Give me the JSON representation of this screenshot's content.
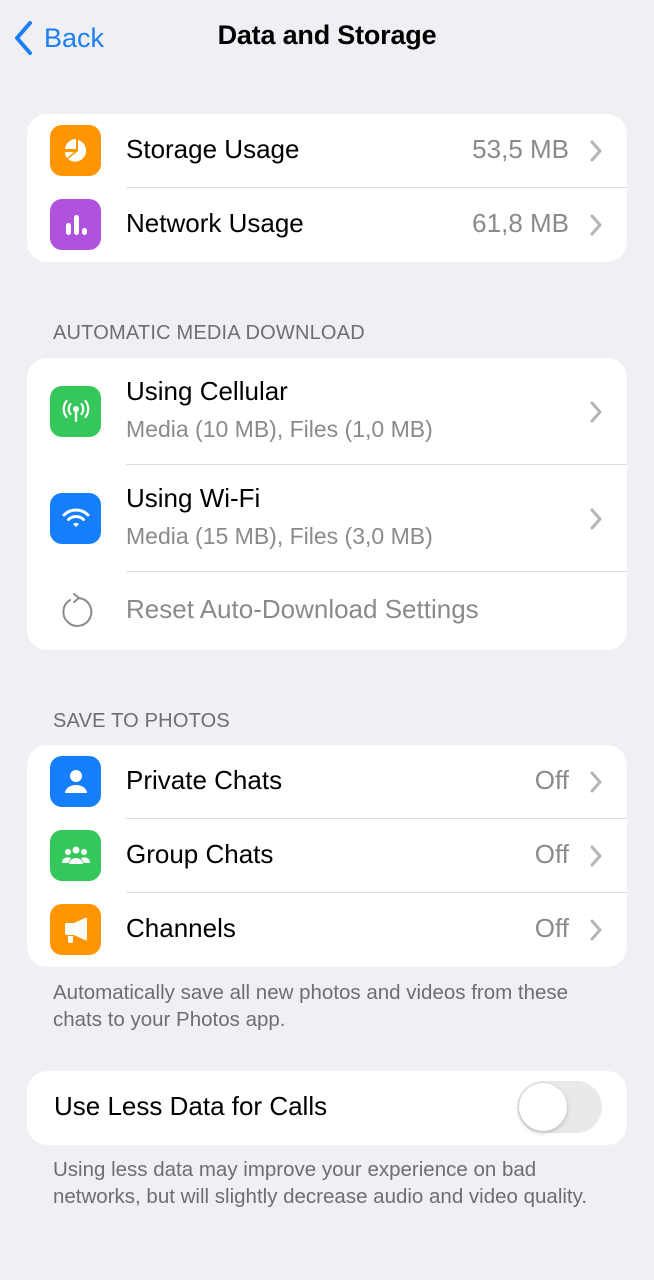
{
  "nav": {
    "back_label": "Back",
    "title": "Data and Storage"
  },
  "usage": {
    "items": [
      {
        "label": "Storage Usage",
        "value": "53,5 MB",
        "icon": "pie-chart-icon",
        "color": "#ff9500"
      },
      {
        "label": "Network Usage",
        "value": "61,8 MB",
        "icon": "bar-chart-icon",
        "color": "#af52de"
      }
    ]
  },
  "auto_download": {
    "header": "AUTOMATIC MEDIA DOWNLOAD",
    "items": [
      {
        "label": "Using Cellular",
        "sublabel": "Media (10 MB), Files (1,0 MB)",
        "icon": "cellular-antenna-icon",
        "color": "#34c759"
      },
      {
        "label": "Using Wi-Fi",
        "sublabel": "Media (15 MB), Files (3,0 MB)",
        "icon": "wifi-icon",
        "color": "#157efb"
      }
    ],
    "reset_label": "Reset Auto-Download Settings"
  },
  "save_to_photos": {
    "header": "SAVE TO PHOTOS",
    "items": [
      {
        "label": "Private Chats",
        "value": "Off",
        "icon": "person-icon",
        "color": "#157efb"
      },
      {
        "label": "Group Chats",
        "value": "Off",
        "icon": "group-icon",
        "color": "#34c759"
      },
      {
        "label": "Channels",
        "value": "Off",
        "icon": "megaphone-icon",
        "color": "#ff9500"
      }
    ],
    "footer": "Automatically save all new photos and videos from these chats to your Photos app."
  },
  "calls": {
    "label": "Use Less Data for Calls",
    "toggle_on": false,
    "footer": "Using less data may improve your experience on bad networks, but will slightly decrease audio and video quality."
  }
}
